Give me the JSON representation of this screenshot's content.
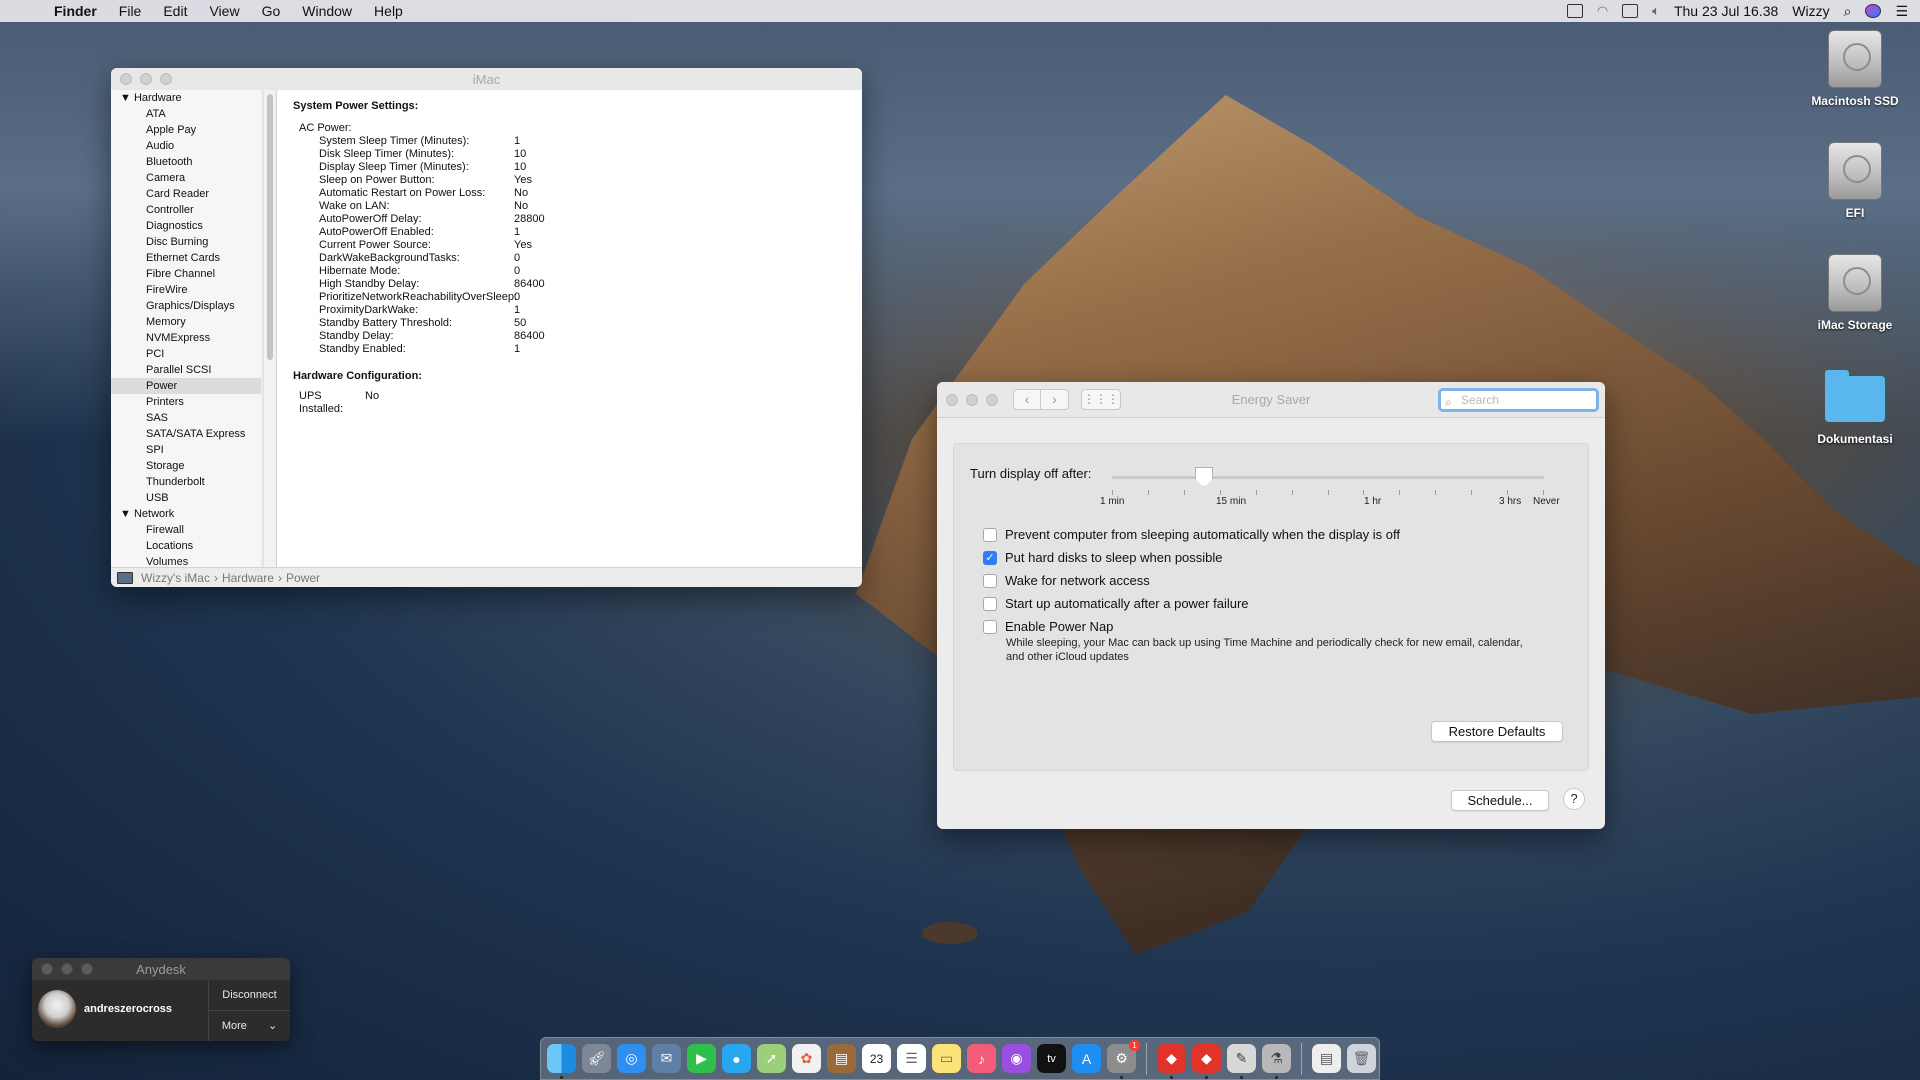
{
  "menubar": {
    "app": "Finder",
    "items": [
      "File",
      "Edit",
      "View",
      "Go",
      "Window",
      "Help"
    ],
    "clock": "Thu 23 Jul  16.38",
    "user": "Wizzy"
  },
  "desktop_icons": [
    {
      "label": "Macintosh SSD",
      "icon": "hard-disk-icon"
    },
    {
      "label": "EFI",
      "icon": "hard-disk-icon"
    },
    {
      "label": "iMac Storage",
      "icon": "hard-disk-icon"
    },
    {
      "label": "Dokumentasi",
      "icon": "folder-icon"
    }
  ],
  "sysinfo": {
    "title": "iMac",
    "sidebar": {
      "hardware_group": "Hardware",
      "hardware_items": [
        "ATA",
        "Apple Pay",
        "Audio",
        "Bluetooth",
        "Camera",
        "Card Reader",
        "Controller",
        "Diagnostics",
        "Disc Burning",
        "Ethernet Cards",
        "Fibre Channel",
        "FireWire",
        "Graphics/Displays",
        "Memory",
        "NVMExpress",
        "PCI",
        "Parallel SCSI",
        "Power",
        "Printers",
        "SAS",
        "SATA/SATA Express",
        "SPI",
        "Storage",
        "Thunderbolt",
        "USB"
      ],
      "selected": "Power",
      "network_group": "Network",
      "network_items": [
        "Firewall",
        "Locations",
        "Volumes"
      ]
    },
    "content": {
      "heading": "System Power Settings:",
      "ac_label": "AC Power:",
      "rows": [
        {
          "k": "System Sleep Timer (Minutes):",
          "v": "1"
        },
        {
          "k": "Disk Sleep Timer (Minutes):",
          "v": "10"
        },
        {
          "k": "Display Sleep Timer (Minutes):",
          "v": "10"
        },
        {
          "k": "Sleep on Power Button:",
          "v": "Yes"
        },
        {
          "k": "Automatic Restart on Power Loss:",
          "v": "No"
        },
        {
          "k": "Wake on LAN:",
          "v": "No"
        },
        {
          "k": "AutoPowerOff Delay:",
          "v": "28800"
        },
        {
          "k": "AutoPowerOff Enabled:",
          "v": "1"
        },
        {
          "k": "Current Power Source:",
          "v": "Yes"
        },
        {
          "k": "DarkWakeBackgroundTasks:",
          "v": "0"
        },
        {
          "k": "Hibernate Mode:",
          "v": "0"
        },
        {
          "k": "High Standby Delay:",
          "v": "86400"
        },
        {
          "k": "PrioritizeNetworkReachabilityOverSleep:",
          "v": "0"
        },
        {
          "k": "ProximityDarkWake:",
          "v": "1"
        },
        {
          "k": "Standby Battery Threshold:",
          "v": "50"
        },
        {
          "k": "Standby Delay:",
          "v": "86400"
        },
        {
          "k": "Standby Enabled:",
          "v": "1"
        }
      ],
      "hw_heading": "Hardware Configuration:",
      "ups_label": "UPS Installed:",
      "ups_value": "No"
    },
    "path": [
      "Wizzy's iMac",
      "Hardware",
      "Power"
    ]
  },
  "energy": {
    "title": "Energy Saver",
    "search_placeholder": "Search",
    "slider_label": "Turn display off after:",
    "slider_value": "10 min",
    "tick_labels": [
      "1 min",
      "15 min",
      "1 hr",
      "3 hrs",
      "Never"
    ],
    "options": [
      {
        "label": "Prevent computer from sleeping automatically when the display is off",
        "checked": false
      },
      {
        "label": "Put hard disks to sleep when possible",
        "checked": true
      },
      {
        "label": "Wake for network access",
        "checked": false
      },
      {
        "label": "Start up automatically after a power failure",
        "checked": false
      },
      {
        "label": "Enable Power Nap",
        "checked": false
      }
    ],
    "power_nap_note": "While sleeping, your Mac can back up using Time Machine and periodically check for new email, calendar, and other iCloud updates",
    "restore_label": "Restore Defaults",
    "schedule_label": "Schedule...",
    "help_label": "?"
  },
  "anydesk": {
    "title": "Anydesk",
    "user": "andreszerocross",
    "disconnect": "Disconnect",
    "more": "More"
  },
  "dock": {
    "calendar_day": "23",
    "prefs_badge": "1"
  }
}
